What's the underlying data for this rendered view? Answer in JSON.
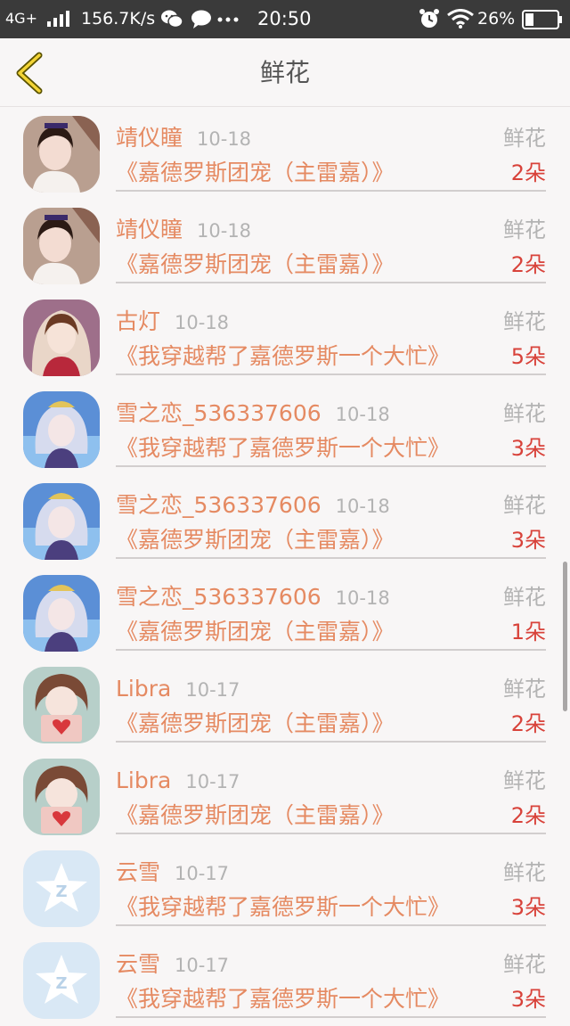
{
  "status_bar": {
    "network": "4G+",
    "speed": "156.7K/s",
    "time": "20:50",
    "battery": "26%"
  },
  "header": {
    "title": "鲜花"
  },
  "items": [
    {
      "name": "靖仪瞳",
      "date": "10-18",
      "type": "鲜花",
      "book": "《嘉德罗斯团宠（主雷嘉）》",
      "count": "2朵",
      "avatar": "avatar-girl-1"
    },
    {
      "name": "靖仪瞳",
      "date": "10-18",
      "type": "鲜花",
      "book": "《嘉德罗斯团宠（主雷嘉）》",
      "count": "2朵",
      "avatar": "avatar-girl-1"
    },
    {
      "name": "古灯",
      "date": "10-18",
      "type": "鲜花",
      "book": "《我穿越帮了嘉德罗斯一个大忙》",
      "count": "5朵",
      "avatar": "avatar-anime-veil"
    },
    {
      "name": "雪之恋_536337606",
      "date": "10-18",
      "type": "鲜花",
      "book": "《我穿越帮了嘉德罗斯一个大忙》",
      "count": "3朵",
      "avatar": "avatar-anime-blue"
    },
    {
      "name": "雪之恋_536337606",
      "date": "10-18",
      "type": "鲜花",
      "book": "《嘉德罗斯团宠（主雷嘉）》",
      "count": "3朵",
      "avatar": "avatar-anime-blue"
    },
    {
      "name": "雪之恋_536337606",
      "date": "10-18",
      "type": "鲜花",
      "book": "《嘉德罗斯团宠（主雷嘉）》",
      "count": "1朵",
      "avatar": "avatar-anime-blue"
    },
    {
      "name": "Libra",
      "date": "10-17",
      "type": "鲜花",
      "book": "《嘉德罗斯团宠（主雷嘉）》",
      "count": "2朵",
      "avatar": "avatar-doll-heart"
    },
    {
      "name": "Libra",
      "date": "10-17",
      "type": "鲜花",
      "book": "《嘉德罗斯团宠（主雷嘉）》",
      "count": "2朵",
      "avatar": "avatar-doll-heart"
    },
    {
      "name": "云雪",
      "date": "10-17",
      "type": "鲜花",
      "book": "《我穿越帮了嘉德罗斯一个大忙》",
      "count": "3朵",
      "avatar": "avatar-default-star"
    },
    {
      "name": "云雪",
      "date": "10-17",
      "type": "鲜花",
      "book": "《我穿越帮了嘉德罗斯一个大忙》",
      "count": "3朵",
      "avatar": "avatar-default-star"
    }
  ]
}
